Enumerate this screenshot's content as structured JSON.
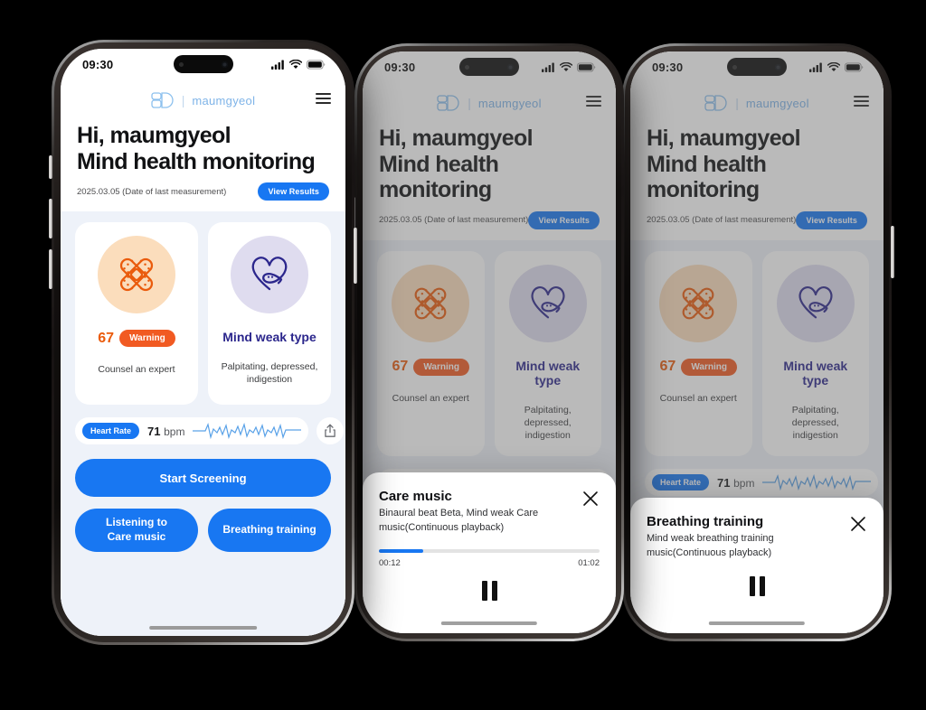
{
  "status_bar": {
    "time": "09:30",
    "signal_icon": "cellular-signal-icon",
    "wifi_icon": "wifi-icon",
    "battery_icon": "battery-icon"
  },
  "app": {
    "logo_icon": "maumgyeol-logo-icon",
    "logo_text": "maumgyeol",
    "menu_icon": "hamburger-menu-icon",
    "greeting_line1": "Hi, maumgyeol",
    "greeting_line2": "Mind health monitoring",
    "last_measurement": "2025.03.05 (Date of last measurement)",
    "view_results_label": "View Results"
  },
  "cards": {
    "score_card": {
      "icon": "crossed-bandage-icon",
      "score": "67",
      "badge": "Warning",
      "note": "Counsel an expert"
    },
    "type_card": {
      "icon": "mind-heart-icon",
      "title": "Mind weak type",
      "note": "Palpitating, depressed, indigestion"
    }
  },
  "heart_rate": {
    "chip_label": "Heart Rate",
    "value": "71",
    "unit": "bpm",
    "ecg_icon": "ecg-waveform-icon",
    "share_icon": "share-icon"
  },
  "actions": {
    "start_screening": "Start Screening",
    "listening_care_music": "Listening to Care music",
    "breathing_training": "Breathing training"
  },
  "care_music_sheet": {
    "title": "Care music",
    "description": "Binaural beat Beta, Mind weak Care music(Continuous playback)",
    "close_icon": "close-icon",
    "elapsed": "00:12",
    "duration": "01:02",
    "progress_percent": 20,
    "pause_icon": "pause-icon"
  },
  "breathing_sheet": {
    "title": "Breathing training",
    "description": "Mind weak breathing training music(Continuous playback)",
    "close_icon": "close-icon",
    "pause_icon": "pause-icon"
  },
  "colors": {
    "brand_blue": "#1877F2",
    "warning_orange": "#F15A22",
    "score_orange": "#EA5B0C",
    "type_navy": "#2B268C",
    "screen_bg": "#eef2f9",
    "logo_blue": "#7fb4e8"
  }
}
